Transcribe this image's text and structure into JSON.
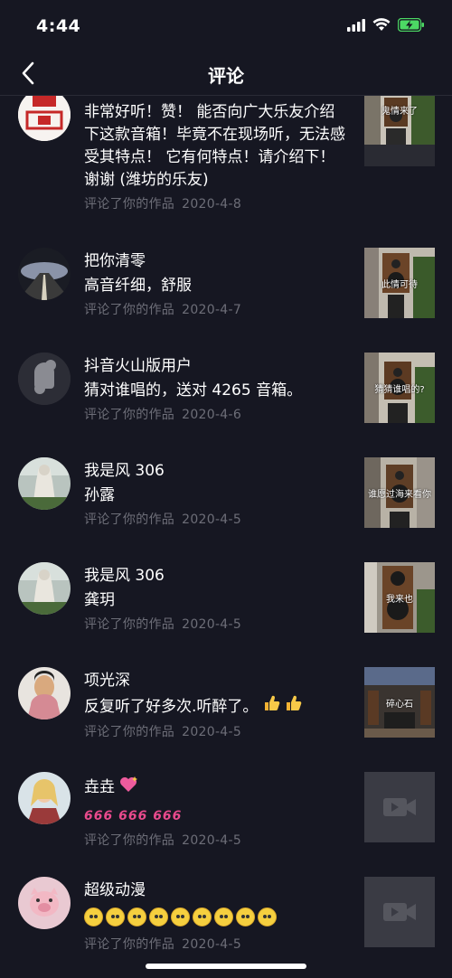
{
  "status": {
    "time": "4:44"
  },
  "nav": {
    "title": "评论"
  },
  "comments": [
    {
      "name": "",
      "text": "非常好听！赞！ 能否向广大乐友介绍下这款音箱！毕竟不在现场听，无法感受其特点！ 它有何特点！请介绍下！谢谢 (潍坊的乐友)",
      "meta": "评论了你的作品",
      "date": "2020-4-8",
      "thumb_caption": "鬼情来了"
    },
    {
      "name": "把你清零",
      "text": "高音纤细，舒服",
      "meta": "评论了你的作品",
      "date": "2020-4-7",
      "thumb_caption": "此情可待"
    },
    {
      "name": "抖音火山版用户",
      "text": "猜对谁唱的，送对 4265 音箱。",
      "meta": "评论了你的作品",
      "date": "2020-4-6",
      "thumb_caption": "猜猜谁唱的?"
    },
    {
      "name": "我是风 306",
      "text": "孙露",
      "meta": "评论了你的作品",
      "date": "2020-4-5",
      "thumb_caption": "谁愿过海来看你"
    },
    {
      "name": "我是风 306",
      "text": "龚玥",
      "meta": "评论了你的作品",
      "date": "2020-4-5",
      "thumb_caption": "我来也"
    },
    {
      "name": "项光深",
      "text": "反复听了好多次.听醉了。",
      "meta": "评论了你的作品",
      "date": "2020-4-5",
      "thumb_caption": "碎心石"
    },
    {
      "name": "垚垚",
      "text": "666 666 666",
      "meta": "评论了你的作品",
      "date": "2020-4-5",
      "thumb_caption": ""
    },
    {
      "name": "超级动漫",
      "text": "",
      "meta": "评论了你的作品",
      "date": "2020-4-5",
      "thumb_caption": ""
    }
  ],
  "icons": {
    "back": "chevron-left-icon",
    "signal": "signal-icon",
    "wifi": "wifi-icon",
    "battery": "battery-charging-icon",
    "video_placeholder": "video-camera-icon",
    "thumbs_up": "thumbs-up-icon",
    "heart": "sparkling-heart-icon",
    "emoji": "flushed-face-icon"
  },
  "colors": {
    "background": "#161722",
    "meta_text": "#6d6e78",
    "battery": "#4cd964"
  }
}
